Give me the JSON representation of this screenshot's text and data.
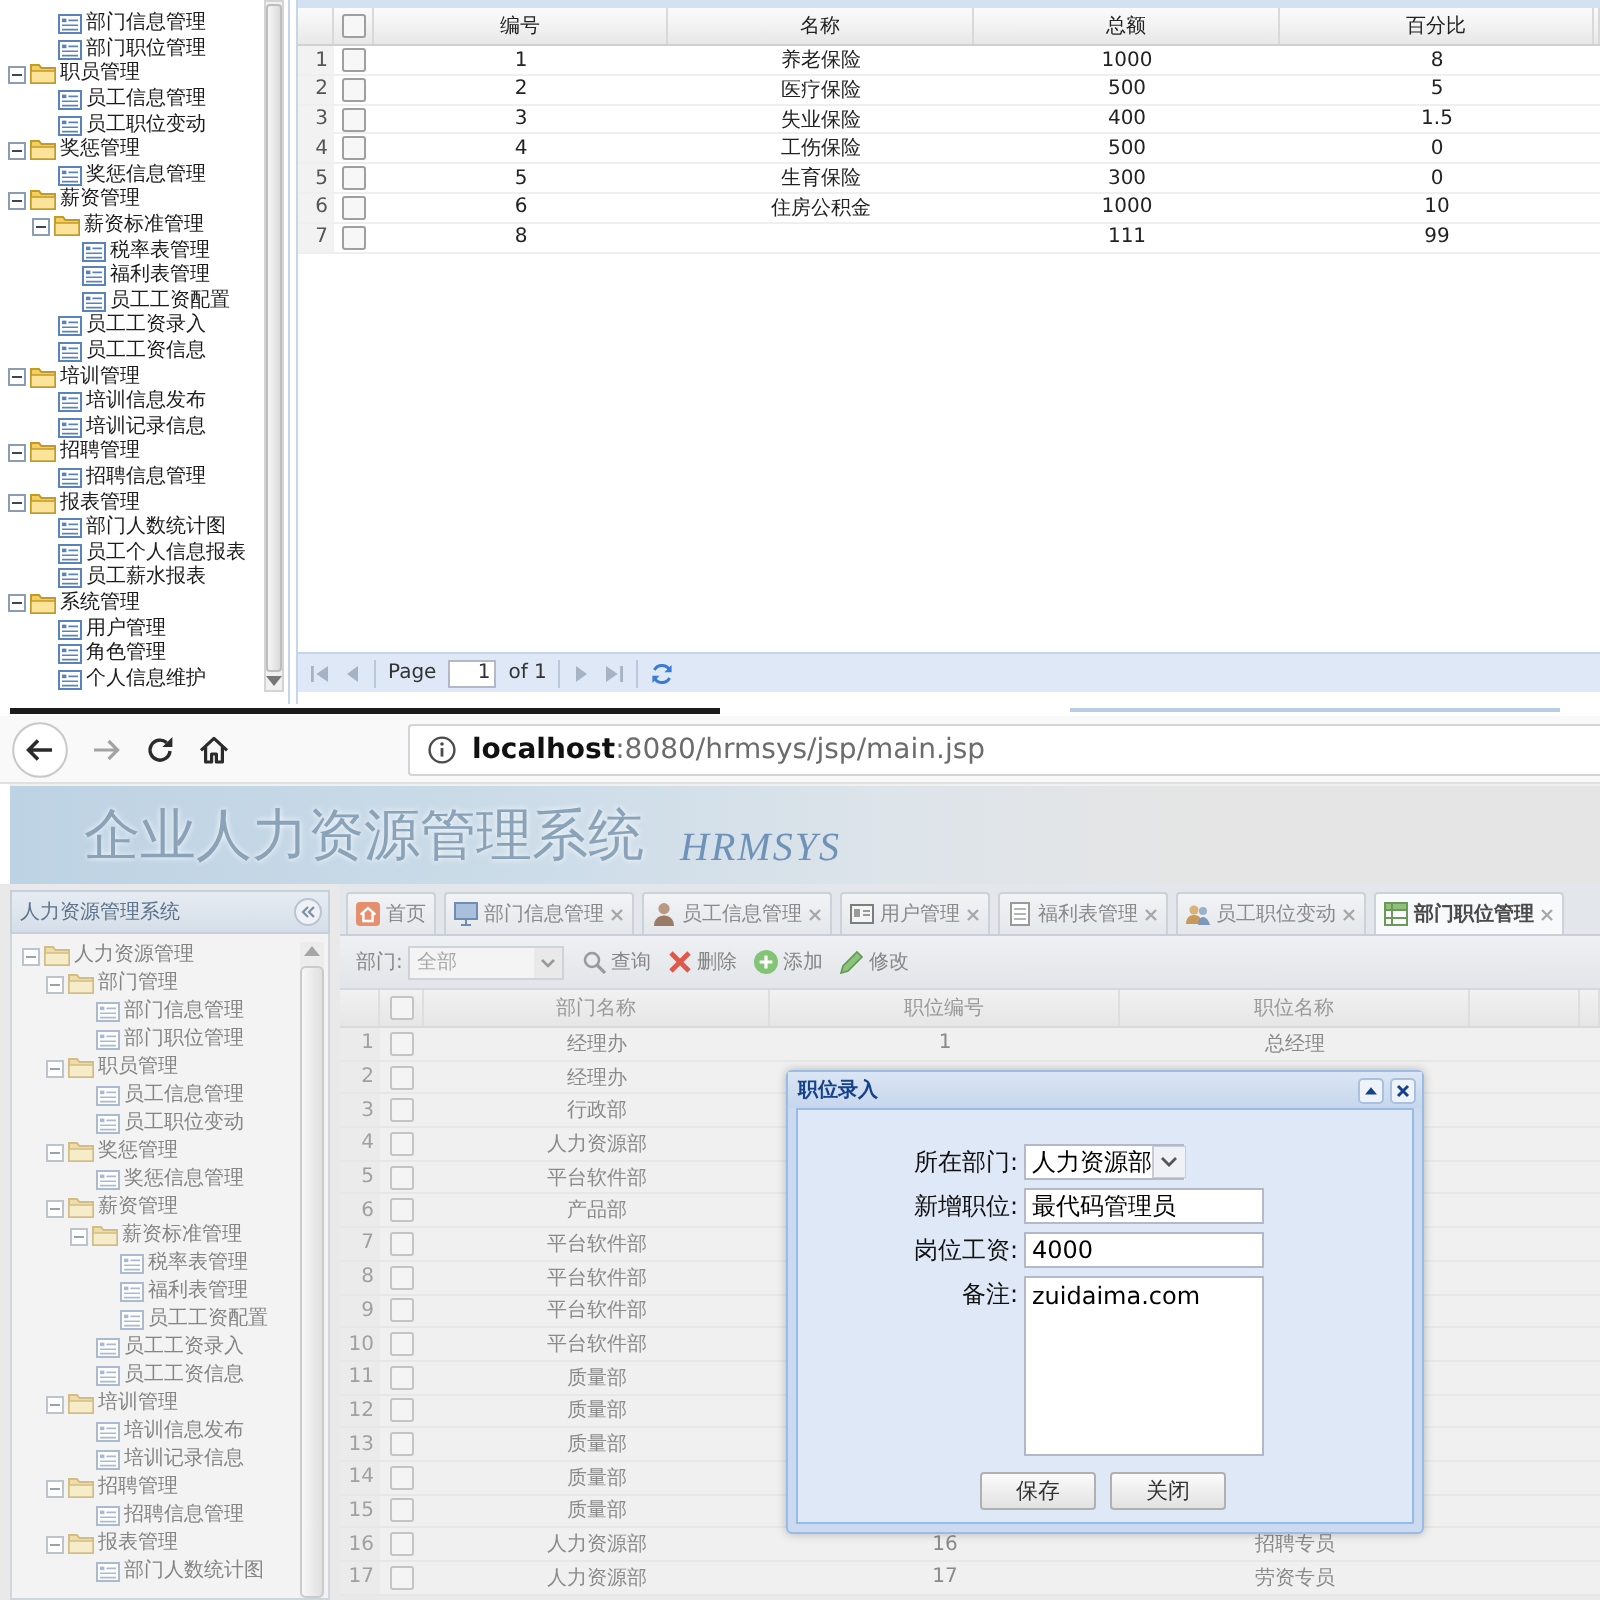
{
  "top_panel": {
    "tree": [
      {
        "children": [
          {
            "kind": "page",
            "label": "部门信息管理"
          },
          {
            "kind": "page",
            "label": "部门职位管理"
          }
        ]
      },
      {
        "kind": "folder",
        "label": "职员管理",
        "expanded": true,
        "children": [
          {
            "kind": "page",
            "label": "员工信息管理"
          },
          {
            "kind": "page",
            "label": "员工职位变动"
          }
        ]
      },
      {
        "kind": "folder",
        "label": "奖惩管理",
        "expanded": true,
        "children": [
          {
            "kind": "page",
            "label": "奖惩信息管理"
          }
        ]
      },
      {
        "kind": "folder",
        "label": "薪资管理",
        "expanded": true,
        "children": [
          {
            "kind": "folder",
            "label": "薪资标准管理",
            "expanded": true,
            "children": [
              {
                "kind": "page",
                "label": "税率表管理"
              },
              {
                "kind": "page",
                "label": "福利表管理"
              },
              {
                "kind": "page",
                "label": "员工工资配置"
              }
            ]
          },
          {
            "kind": "page",
            "label": "员工工资录入"
          },
          {
            "kind": "page",
            "label": "员工工资信息"
          }
        ]
      },
      {
        "kind": "folder",
        "label": "培训管理",
        "expanded": true,
        "children": [
          {
            "kind": "page",
            "label": "培训信息发布"
          },
          {
            "kind": "page",
            "label": "培训记录信息"
          }
        ]
      },
      {
        "kind": "folder",
        "label": "招聘管理",
        "expanded": true,
        "children": [
          {
            "kind": "page",
            "label": "招聘信息管理"
          }
        ]
      },
      {
        "kind": "folder",
        "label": "报表管理",
        "expanded": true,
        "children": [
          {
            "kind": "page",
            "label": "部门人数统计图"
          },
          {
            "kind": "page",
            "label": "员工个人信息报表"
          },
          {
            "kind": "page",
            "label": "员工薪水报表"
          }
        ]
      },
      {
        "kind": "folder",
        "label": "系统管理",
        "expanded": true,
        "children": [
          {
            "kind": "page",
            "label": "用户管理"
          },
          {
            "kind": "page",
            "label": "角色管理"
          },
          {
            "kind": "page",
            "label": "个人信息维护"
          }
        ]
      }
    ],
    "grid": {
      "columns": [
        "编号",
        "名称",
        "总额",
        "百分比"
      ],
      "header_checked": false,
      "rows": [
        {
          "row_number": "1",
          "checked": false,
          "number": "1",
          "name": "养老保险",
          "total": "1000",
          "percentage": "8"
        },
        {
          "row_number": "2",
          "checked": false,
          "number": "2",
          "name": "医疗保险",
          "total": "500",
          "percentage": "5"
        },
        {
          "row_number": "3",
          "checked": false,
          "number": "3",
          "name": "失业保险",
          "total": "400",
          "percentage": "1.5"
        },
        {
          "row_number": "4",
          "checked": false,
          "number": "4",
          "name": "工伤保险",
          "total": "500",
          "percentage": "0"
        },
        {
          "row_number": "5",
          "checked": false,
          "number": "5",
          "name": "生育保险",
          "total": "300",
          "percentage": "0"
        },
        {
          "row_number": "6",
          "checked": false,
          "number": "6",
          "name": "住房公积金",
          "total": "1000",
          "percentage": "10"
        },
        {
          "row_number": "7",
          "checked": false,
          "number": "8",
          "total": "111",
          "percentage": "99"
        }
      ]
    },
    "pager": {
      "label": "Page",
      "page": "1",
      "count": "of 1"
    }
  },
  "browser": {
    "url": "**localhost**:8080/hrmsys/jsp/main.jsp"
  },
  "app": {
    "banner": {
      "title": "企业人力资源管理系统",
      "logo": "HRMSYS"
    },
    "sidebar": {
      "title": "人力资源管理系统",
      "tree": [
        {
          "kind": "folder",
          "label": "人力资源管理",
          "expanded": true,
          "children": [
            {
              "kind": "folder",
              "label": "部门管理",
              "expanded": true,
              "children": [
                {
                  "kind": "page",
                  "label": "部门信息管理"
                },
                {
                  "kind": "page",
                  "label": "部门职位管理"
                }
              ]
            },
            {
              "kind": "folder",
              "label": "职员管理",
              "expanded": true,
              "children": [
                {
                  "kind": "page",
                  "label": "员工信息管理"
                },
                {
                  "kind": "page",
                  "label": "员工职位变动"
                }
              ]
            },
            {
              "kind": "folder",
              "label": "奖惩管理",
              "expanded": true,
              "children": [
                {
                  "kind": "page",
                  "label": "奖惩信息管理"
                }
              ]
            },
            {
              "kind": "folder",
              "label": "薪资管理",
              "expanded": true,
              "children": [
                {
                  "kind": "folder",
                  "label": "薪资标准管理",
                  "expanded": true,
                  "children": [
                    {
                      "kind": "page",
                      "label": "税率表管理"
                    },
                    {
                      "kind": "page",
                      "label": "福利表管理"
                    },
                    {
                      "kind": "page",
                      "label": "员工工资配置"
                    }
                  ]
                },
                {
                  "kind": "page",
                  "label": "员工工资录入"
                },
                {
                  "kind": "page",
                  "label": "员工工资信息"
                }
              ]
            },
            {
              "kind": "folder",
              "label": "培训管理",
              "expanded": true,
              "children": [
                {
                  "kind": "page",
                  "label": "培训信息发布"
                },
                {
                  "kind": "page",
                  "label": "培训记录信息"
                }
              ]
            },
            {
              "kind": "folder",
              "label": "招聘管理",
              "expanded": true,
              "children": [
                {
                  "kind": "page",
                  "label": "招聘信息管理"
                }
              ]
            },
            {
              "kind": "folder",
              "label": "报表管理",
              "expanded": true,
              "children": [
                {
                  "kind": "page",
                  "label": "部门人数统计图"
                }
              ]
            }
          ]
        }
      ]
    },
    "tabs": [
      {
        "label": "首页",
        "selected": false,
        "closable": false
      },
      {
        "label": "部门信息管理",
        "selected": false,
        "closable": true
      },
      {
        "label": "员工信息管理",
        "selected": false,
        "closable": true
      },
      {
        "label": "用户管理",
        "selected": false,
        "closable": true
      },
      {
        "label": "福利表管理",
        "selected": false,
        "closable": true
      },
      {
        "label": "员工职位变动",
        "selected": false,
        "closable": true
      },
      {
        "label": "部门职位管理",
        "selected": true,
        "closable": true
      }
    ],
    "toolbar": {
      "filter_label": "部门:",
      "filter_value": "全部",
      "buttons": [
        "查询",
        "删除",
        "添加",
        "修改"
      ]
    },
    "grid": {
      "columns": [
        "部门名称",
        "职位编号",
        "职位名称"
      ],
      "header_checked": false,
      "rows": [
        {
          "row_number": "1",
          "checked": false,
          "department": "经理办",
          "position_id": "1",
          "position_name": "总经理"
        },
        {
          "row_number": "2",
          "checked": false,
          "department": "经理办"
        },
        {
          "row_number": "3",
          "checked": false,
          "department": "行政部"
        },
        {
          "row_number": "4",
          "checked": false,
          "department": "人力资源部"
        },
        {
          "row_number": "5",
          "checked": false,
          "department": "平台软件部"
        },
        {
          "row_number": "6",
          "checked": false,
          "department": "产品部"
        },
        {
          "row_number": "7",
          "checked": false,
          "department": "平台软件部"
        },
        {
          "row_number": "8",
          "checked": false,
          "department": "平台软件部"
        },
        {
          "row_number": "9",
          "checked": false,
          "department": "平台软件部"
        },
        {
          "row_number": "10",
          "checked": false,
          "department": "平台软件部"
        },
        {
          "row_number": "11",
          "checked": false,
          "department": "质量部"
        },
        {
          "row_number": "12",
          "checked": false,
          "department": "质量部"
        },
        {
          "row_number": "13",
          "checked": false,
          "department": "质量部"
        },
        {
          "row_number": "14",
          "checked": false,
          "department": "质量部"
        },
        {
          "row_number": "15",
          "checked": false,
          "department": "质量部"
        },
        {
          "row_number": "16",
          "checked": false,
          "department": "人力资源部",
          "position_id": "16",
          "position_name": "招聘专员"
        },
        {
          "row_number": "17",
          "checked": false,
          "department": "人力资源部",
          "position_id": "17",
          "position_name": "劳资专员"
        }
      ]
    },
    "dialog": {
      "title": "职位录入",
      "fields": [
        {
          "kind": "select",
          "label": "所在部门:",
          "value": "人力资源部"
        },
        {
          "kind": "input",
          "label": "新增职位:",
          "value": "最代码管理员"
        },
        {
          "kind": "input",
          "label": "岗位工资:",
          "value": "4000"
        },
        {
          "kind": "textarea",
          "label": "备注:",
          "value": "zuidaima.com"
        }
      ],
      "buttons": [
        "保存",
        "关闭"
      ]
    }
  }
}
